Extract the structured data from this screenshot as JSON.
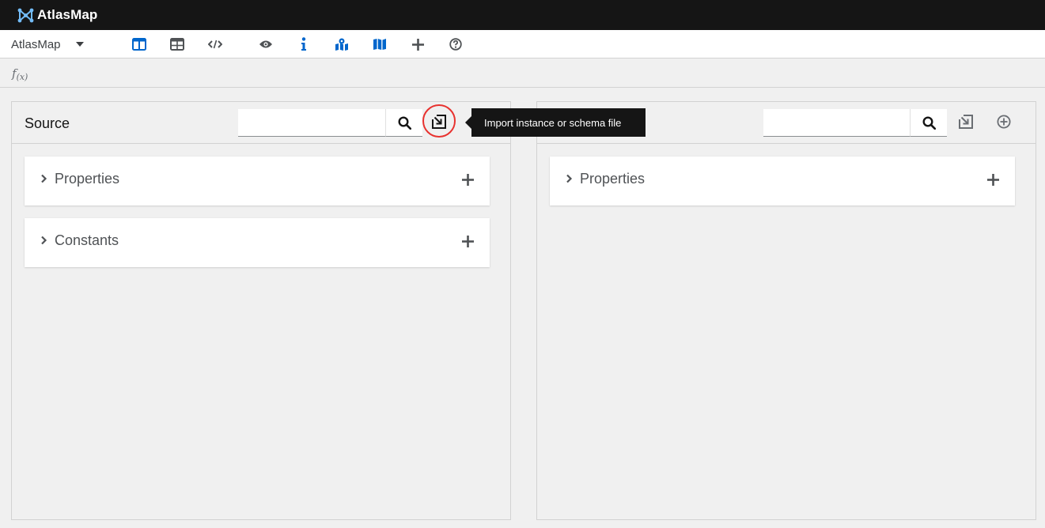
{
  "app": {
    "name": "AtlasMap"
  },
  "toolbar": {
    "app_select_label": "AtlasMap",
    "icons": [
      "columns-view-icon",
      "table-view-icon",
      "code-view-icon",
      "eye-icon",
      "info-icon",
      "map-marker-icon",
      "map-icon",
      "plus-icon",
      "help-icon"
    ]
  },
  "fx_bar": {
    "f": "f",
    "x": "(x)"
  },
  "source": {
    "title": "Source",
    "search_placeholder": "",
    "cards": [
      {
        "label": "Properties"
      },
      {
        "label": "Constants"
      }
    ]
  },
  "target": {
    "title": "",
    "search_placeholder": "",
    "cards": [
      {
        "label": "Properties"
      }
    ]
  },
  "tooltip": {
    "text": "Import instance or schema file"
  },
  "colors": {
    "masthead": "#151515",
    "accent_blue": "#0066cc",
    "highlight": "#e8322f",
    "logo": "#73bcf7"
  }
}
